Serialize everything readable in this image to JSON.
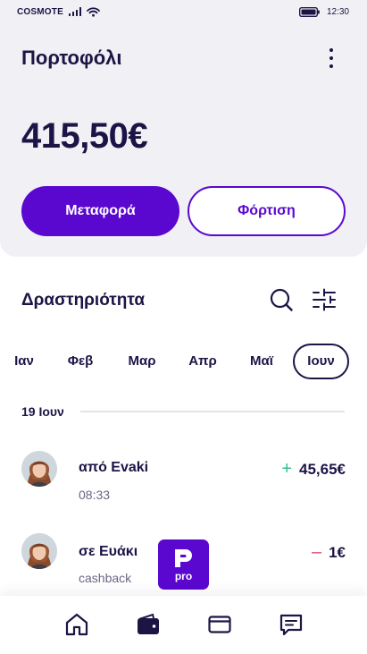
{
  "status": {
    "carrier": "COSMOTE",
    "time": "12:30",
    "icons": [
      "signal-icon",
      "wifi-icon",
      "battery-icon"
    ]
  },
  "header": {
    "title": "Πορτοφόλι",
    "balance": "415,50€",
    "more_icon": "more-vertical-icon"
  },
  "actions": {
    "transfer_label": "Μεταφορά",
    "topup_label": "Φόρτιση"
  },
  "activity": {
    "title": "Δραστηριότητα",
    "search_icon": "search-icon",
    "filter_icon": "filter-sliders-icon",
    "months": [
      "Ιαν",
      "Φεβ",
      "Μαρ",
      "Απρ",
      "Μαϊ",
      "Ιουν"
    ],
    "selected_month": "Ιουν",
    "date_header": "19 Ιουν"
  },
  "transactions": [
    {
      "title": "από Evaki",
      "subtitle": "08:33",
      "sign": "+",
      "amount": "45,65€"
    },
    {
      "title": "σε Ευάκι",
      "subtitle": "cashback",
      "sign": "–",
      "amount": "1€",
      "badge": "pro"
    }
  ],
  "nav": {
    "items": [
      "home-icon",
      "wallet-icon",
      "card-icon",
      "messages-icon"
    ],
    "active": "wallet-icon"
  },
  "colors": {
    "primary": "#5a07cf",
    "text": "#1d1446",
    "header_bg": "#f1f0f4",
    "positive": "#2bc48a",
    "negative": "#e04a78"
  }
}
